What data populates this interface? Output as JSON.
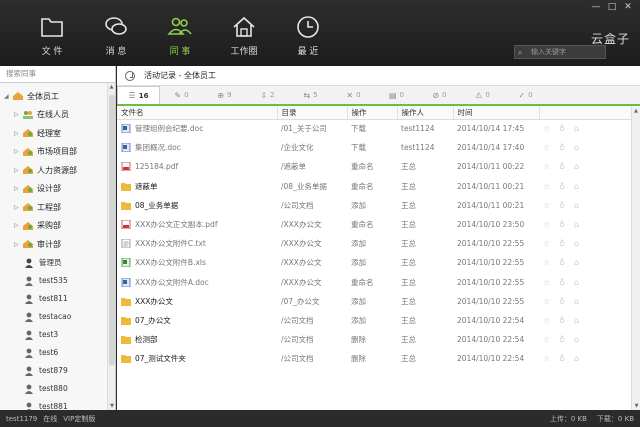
{
  "window": {
    "min": "—",
    "max": "□",
    "close": "✕"
  },
  "nav": [
    {
      "label": "文 件",
      "icon": "folder-icon",
      "active": false
    },
    {
      "label": "消 息",
      "icon": "chat-icon",
      "active": false
    },
    {
      "label": "同 事",
      "icon": "people-icon",
      "active": true
    },
    {
      "label": "工作圈",
      "icon": "house-icon",
      "active": false
    },
    {
      "label": "最 近",
      "icon": "clock-icon",
      "active": false
    }
  ],
  "brand": "云盒子",
  "search_keyword_placeholder": "输入关键字",
  "sidebar": {
    "search_placeholder": "搜索同事",
    "root": "全体员工",
    "depts": [
      "在线人员",
      "经理室",
      "市场项目部",
      "人力资源部",
      "设计部",
      "工程部",
      "采购部",
      "审计部"
    ],
    "people": [
      "管理员",
      "test535",
      "test811",
      "testacao",
      "test3",
      "test6",
      "test879",
      "test880",
      "test881"
    ]
  },
  "breadcrumb": "活动记录 - 全体员工",
  "filters": [
    {
      "glyph": "☰",
      "count": "16",
      "active": true
    },
    {
      "glyph": "✎",
      "count": "0"
    },
    {
      "glyph": "⊕",
      "count": "9"
    },
    {
      "glyph": "⇩",
      "count": "2"
    },
    {
      "glyph": "⇆",
      "count": "5"
    },
    {
      "glyph": "✕",
      "count": "0"
    },
    {
      "glyph": "▤",
      "count": "0"
    },
    {
      "glyph": "⊘",
      "count": "0"
    },
    {
      "glyph": "⚠",
      "count": "0"
    },
    {
      "glyph": "✓",
      "count": "0"
    }
  ],
  "columns": {
    "name": "文件名",
    "dir": "目录",
    "op": "操作",
    "by": "操作人",
    "time": "时间"
  },
  "rows": [
    {
      "type": "doc",
      "name": "管理组例会纪要.doc",
      "dir": "/01_关于公司",
      "op": "下载",
      "by": "test1124",
      "time": "2014/10/14 17:45"
    },
    {
      "type": "doc",
      "name": "集团概况.doc",
      "dir": "/企业文化",
      "op": "下载",
      "by": "test1124",
      "time": "2014/10/14 17:40"
    },
    {
      "type": "pdf",
      "name": "125184.pdf",
      "dir": "/遮蔽单",
      "op": "重命名",
      "by": "王总",
      "time": "2014/10/11 00:22"
    },
    {
      "type": "folder",
      "name": "遮蔽单",
      "dir": "/08_业务单据",
      "op": "重命名",
      "by": "王总",
      "time": "2014/10/11 00:21"
    },
    {
      "type": "folder",
      "name": "08_业务单据",
      "dir": "/公司文档",
      "op": "添加",
      "by": "王总",
      "time": "2014/10/11 00:21"
    },
    {
      "type": "pdf",
      "name": "XXX办公文正文副本.pdf",
      "dir": "/XXX办公文",
      "op": "重命名",
      "by": "王总",
      "time": "2014/10/10 23:50"
    },
    {
      "type": "txt",
      "name": "XXX办公文附件C.txt",
      "dir": "/XXX办公文",
      "op": "添加",
      "by": "王总",
      "time": "2014/10/10 22:55"
    },
    {
      "type": "xls",
      "name": "XXX办公文附件B.xls",
      "dir": "/XXX办公文",
      "op": "添加",
      "by": "王总",
      "time": "2014/10/10 22:55"
    },
    {
      "type": "doc",
      "name": "XXX办公文附件A.doc",
      "dir": "/XXX办公文",
      "op": "重命名",
      "by": "王总",
      "time": "2014/10/10 22:55"
    },
    {
      "type": "folder",
      "name": "XXX办公文",
      "dir": "/07_办公文",
      "op": "添加",
      "by": "王总",
      "time": "2014/10/10 22:55"
    },
    {
      "type": "folder",
      "name": "07_办公文",
      "dir": "/公司文档",
      "op": "添加",
      "by": "王总",
      "time": "2014/10/10 22:54"
    },
    {
      "type": "folder",
      "name": "检测部",
      "dir": "/公司文档",
      "op": "删除",
      "by": "王总",
      "time": "2014/10/10 22:54"
    },
    {
      "type": "folder",
      "name": "07_测试文件夹",
      "dir": "/公司文档",
      "op": "删除",
      "by": "王总",
      "time": "2014/10/10 22:54"
    }
  ],
  "status": {
    "user": "test1179",
    "state": "在线",
    "edition": "VIP定制版",
    "upload": "上传：0 KB",
    "download": "下载：0 KB"
  }
}
